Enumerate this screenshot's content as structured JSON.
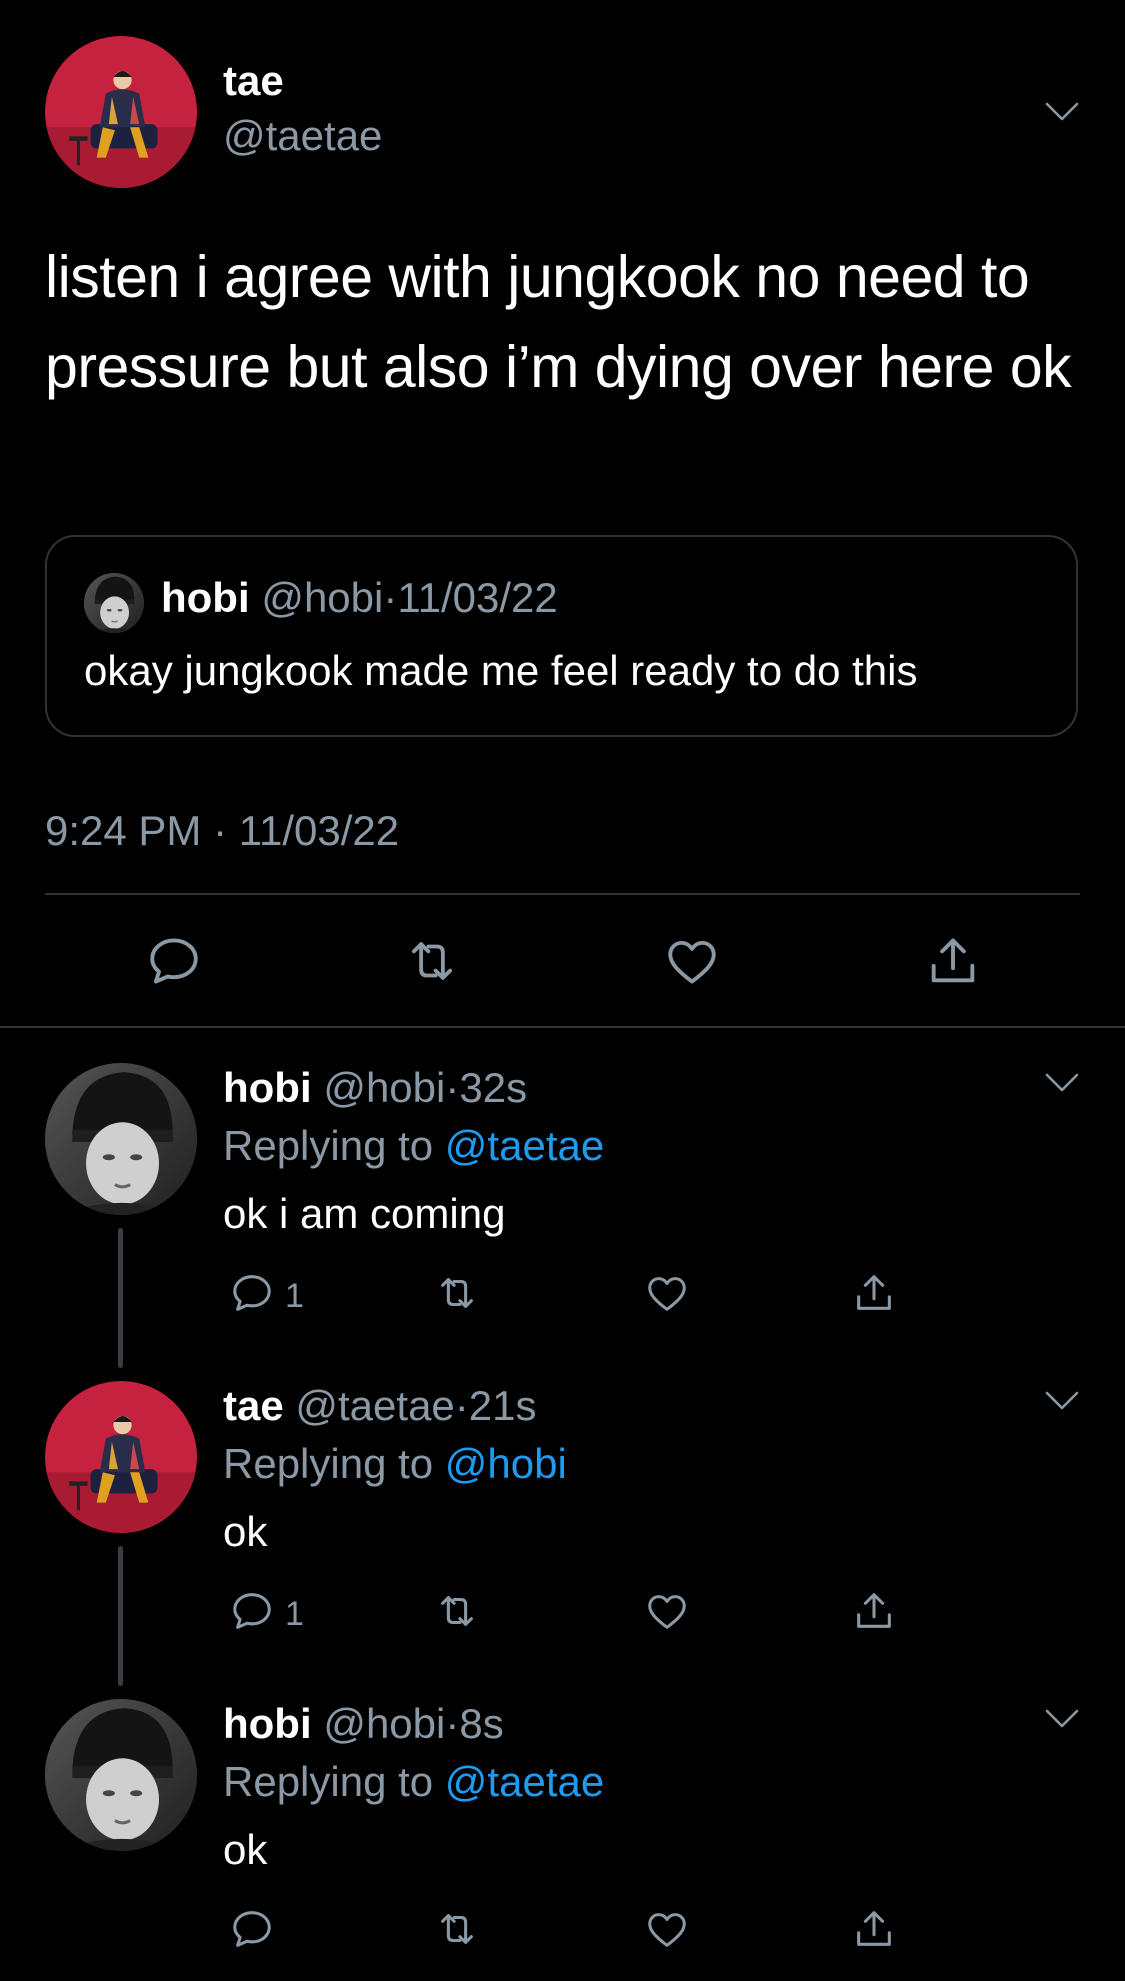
{
  "main_tweet": {
    "author_name": "tae",
    "author_handle": "@taetae",
    "text": "listen i agree with jungkook no need to pressure but also i’m dying over here ok",
    "quote": {
      "author_name": "hobi",
      "author_handle": "@hobi",
      "separator": "·",
      "date": "11/03/22",
      "text": "okay jungkook made me feel ready to do this"
    },
    "timestamp": "9:24 PM · 11/03/22",
    "actions": [
      "reply-icon",
      "retweet-icon",
      "like-icon",
      "share-icon"
    ]
  },
  "replies": [
    {
      "author_name": "hobi",
      "author_handle": "@hobi",
      "separator": "·",
      "time": "32s",
      "replying_prefix": "Replying to",
      "replying_to": "@taetae",
      "text": "ok i am coming",
      "reply_count": "1"
    },
    {
      "author_name": "tae",
      "author_handle": "@taetae",
      "separator": "·",
      "time": "21s",
      "replying_prefix": "Replying to",
      "replying_to": "@hobi",
      "text": "ok",
      "reply_count": "1"
    },
    {
      "author_name": "hobi",
      "author_handle": "@hobi",
      "separator": "·",
      "time": "8s",
      "replying_prefix": "Replying to",
      "replying_to": "@taetae",
      "text": "ok",
      "reply_count": ""
    }
  ],
  "colors": {
    "background": "#000000",
    "text": "#ffffff",
    "secondary": "#8b98a5",
    "mention": "#1d9bf0",
    "border": "#2f3336",
    "tae_avatar_bg": "#c4223f"
  }
}
